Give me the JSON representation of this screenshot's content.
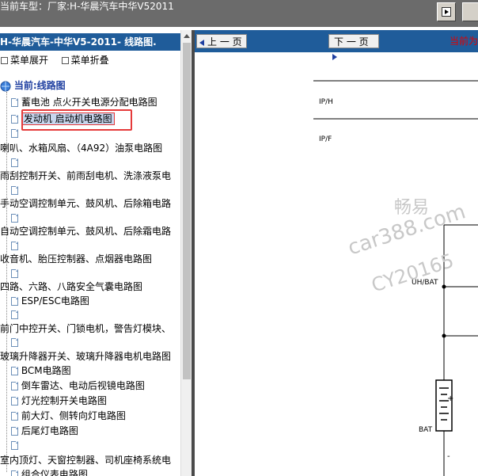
{
  "topbar": {
    "title": "当前车型：厂家:H-华晨汽车中华V52011"
  },
  "left": {
    "header": "H-华晨汽车-中华V5-2011- 线路图.",
    "expand": "菜单展开",
    "collapse": "菜单折叠",
    "current_label": "当前:线路图",
    "items": [
      "蓄电池 点火开关电源分配电路图",
      "发动机 启动机电路图",
      "喇叭、水箱风扇、（4A92）油泵电路图",
      "雨刮控制开关、前雨刮电机、洗涤液泵电",
      "手动空调控制单元、鼓风机、后除箱电路",
      "自动空调控制单元、鼓风机、后除霜电路",
      "收音机、胎压控制器、点烟器电路图",
      "四路、六路、八路安全气囊电路图",
      "ESP/ESC电路图",
      "前门中控开关、门锁电机，警告灯模块、",
      "玻璃升降器开关、玻璃升降器电机电路图",
      "BCM电路图",
      "倒车雷达、电动后视镜电路图",
      "灯光控制开关电路图",
      "前大灯、侧转向灯电路图",
      "后尾灯电路图",
      "室内顶灯、天窗控制器、司机座椅系统电",
      "组合仪表电路图"
    ]
  },
  "nav": {
    "prev": "上 一 页",
    "next": "下 一 页",
    "current_pos": "当前为"
  },
  "diagram": {
    "labels": {
      "iph": "IP/H",
      "ipf": "IP/F",
      "uhbat": "UH/BAT",
      "bat": "BAT",
      "plus": "+",
      "minus": "-"
    },
    "watermark": {
      "line1": "畅易",
      "line2": "car388.com",
      "line3": "CY20165"
    }
  },
  "colors": {
    "header_blue": "#1f5c9a",
    "highlight_red": "#e53a3a",
    "titlebar_gray": "#6b6b6b"
  }
}
